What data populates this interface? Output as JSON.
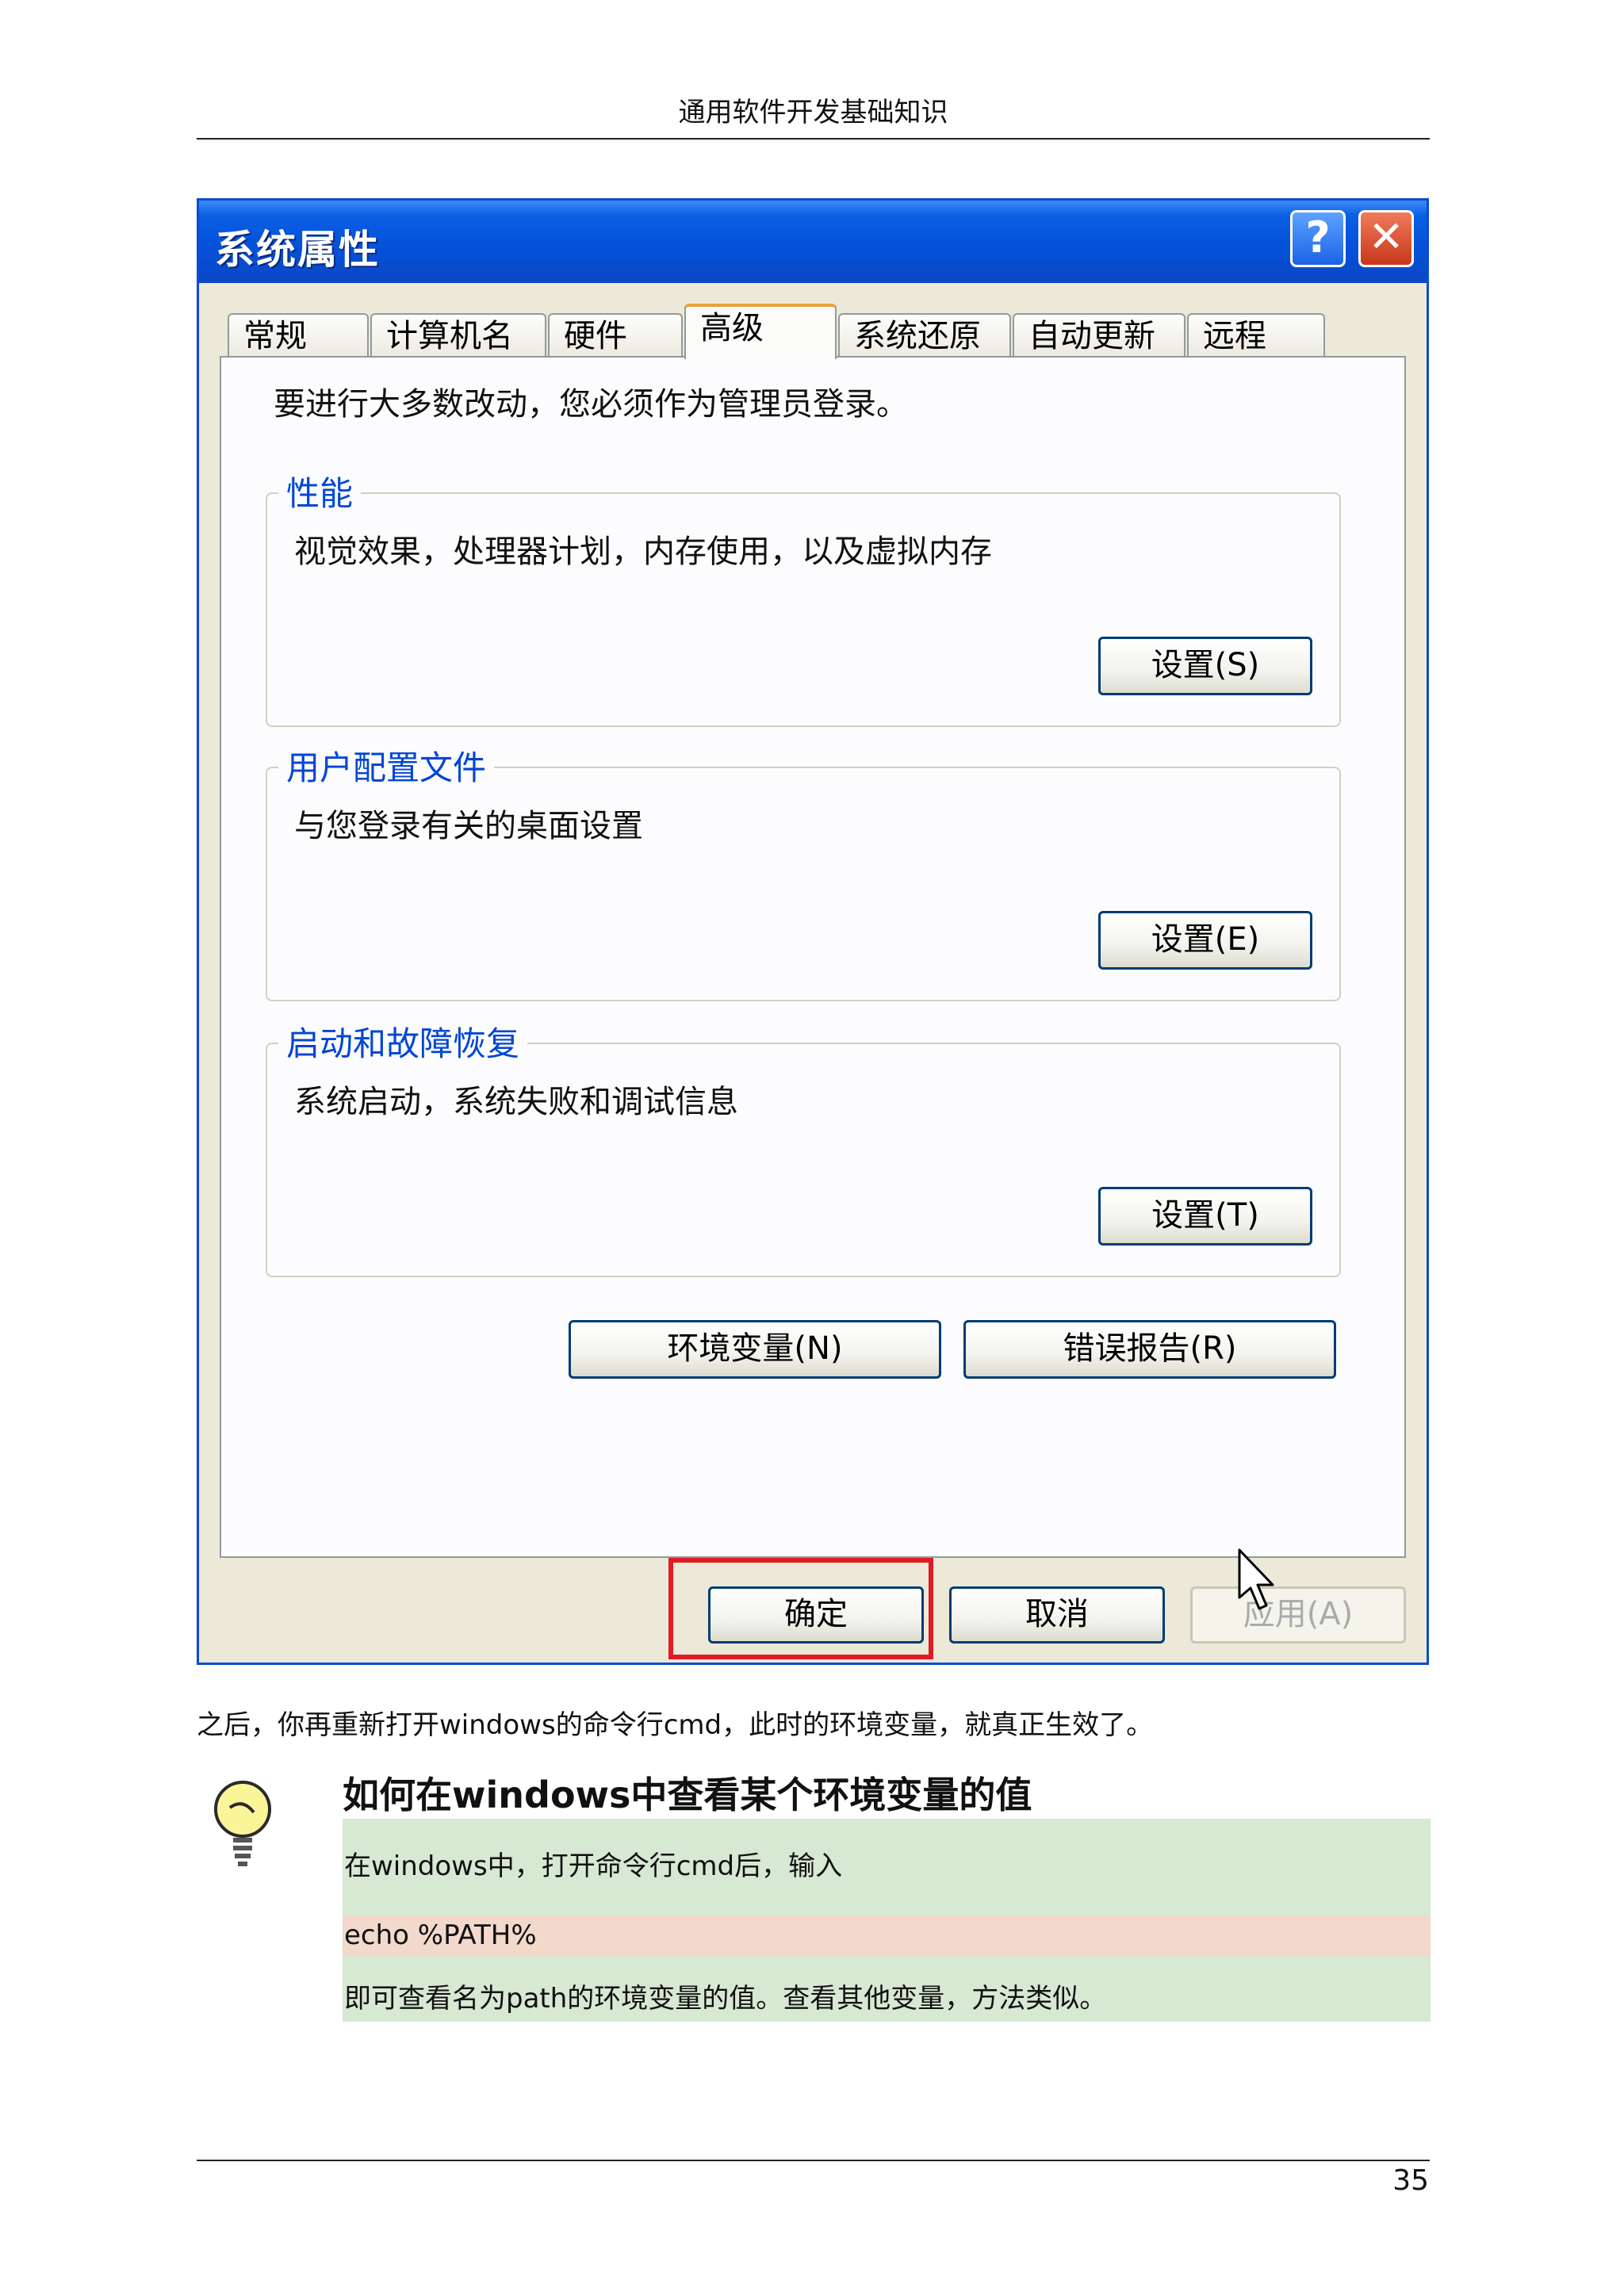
{
  "header": {
    "title": "通用软件开发基础知识"
  },
  "dialog": {
    "title": "系统属性",
    "help_label": "?",
    "close_label": "✕",
    "tabs": [
      "常规",
      "计算机名",
      "硬件",
      "高级",
      "系统还原",
      "自动更新",
      "远程"
    ],
    "active_tab": "高级",
    "intro": "要进行大多数改动，您必须作为管理员登录。",
    "groups": [
      {
        "legend": "性能",
        "description": "视觉效果，处理器计划，内存使用，以及虚拟内存",
        "button": "设置(S)"
      },
      {
        "legend": "用户配置文件",
        "description": "与您登录有关的桌面设置",
        "button": "设置(E)"
      },
      {
        "legend": "启动和故障恢复",
        "description": "系统启动，系统失败和调试信息",
        "button": "设置(T)"
      }
    ],
    "env_button": "环境变量(N)",
    "error_button": "错误报告(R)",
    "ok_button": "确定",
    "cancel_button": "取消",
    "apply_button": "应用(A)"
  },
  "body": {
    "paragraph": "之后，你再重新打开windows的命令行cmd，此时的环境变量，就真正生效了。",
    "tip_title": "如何在windows中查看某个环境变量的值",
    "tip_line1": "在windows中，打开命令行cmd后，输入",
    "tip_code": "echo %PATH%",
    "tip_line2": "即可查看名为path的环境变量的值。查看其他变量，方法类似。"
  },
  "footer": {
    "page_number": "35"
  },
  "icons": {
    "tip": "lightbulb-icon",
    "cursor": "mouse-pointer-icon"
  }
}
